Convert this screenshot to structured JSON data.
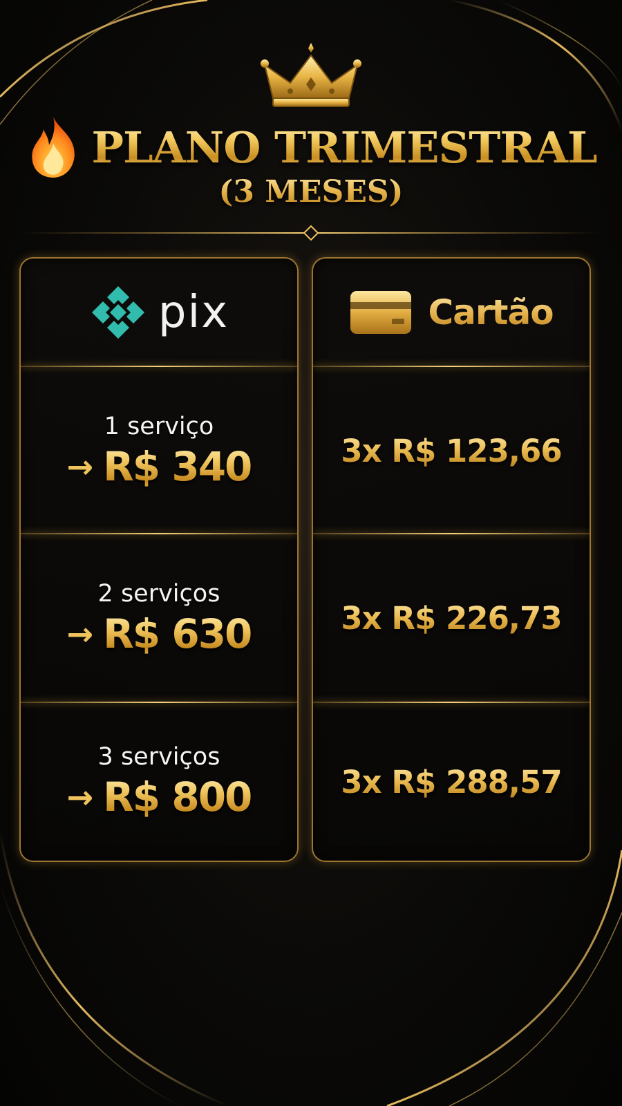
{
  "colors": {
    "gold": "#e8b94a",
    "pix_teal": "#32bcad",
    "background": "#0b0a08"
  },
  "header": {
    "crown_icon": "crown-icon",
    "fire_icon": "fire-emoji-icon",
    "title": "PLANO TRIMESTRAL",
    "subtitle": "(3 MESES)"
  },
  "pix": {
    "logo_icon": "pix-logo-icon",
    "label": "pix",
    "arrow": "→",
    "rows": [
      {
        "service": "1 serviço",
        "price": "R$ 340"
      },
      {
        "service": "2 serviços",
        "price": "R$ 630"
      },
      {
        "service": "3 serviços",
        "price": "R$ 800"
      }
    ]
  },
  "cartao": {
    "card_icon": "credit-card-icon",
    "label": "Cartão",
    "rows": [
      {
        "installment": "3x R$ 123,66"
      },
      {
        "installment": "3x R$ 226,73"
      },
      {
        "installment": "3x R$ 288,57"
      }
    ]
  }
}
